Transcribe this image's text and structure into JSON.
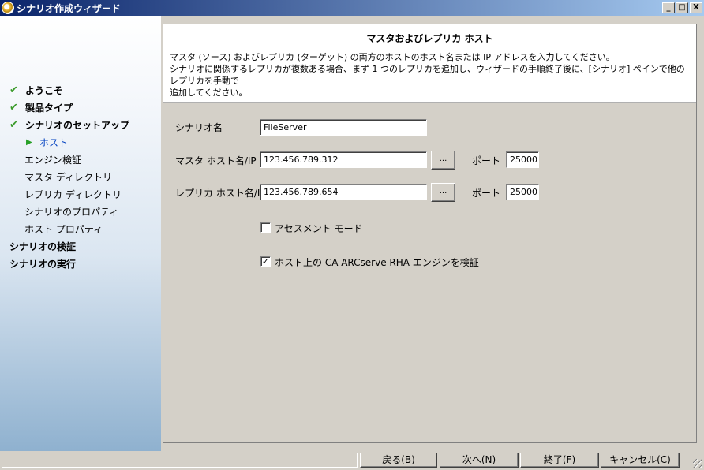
{
  "window": {
    "title": "シナリオ作成ウィザード",
    "minimize": "_",
    "maximize": "□",
    "close": "X"
  },
  "nav": {
    "items": [
      {
        "label": "ようこそ",
        "state": "done"
      },
      {
        "label": "製品タイプ",
        "state": "done"
      },
      {
        "label": "シナリオのセットアップ",
        "state": "done"
      },
      {
        "label": "ホスト",
        "state": "current"
      },
      {
        "label": "エンジン検証",
        "state": "pending"
      },
      {
        "label": "マスタ ディレクトリ",
        "state": "pending"
      },
      {
        "label": "レプリカ ディレクトリ",
        "state": "pending"
      },
      {
        "label": "シナリオのプロパティ",
        "state": "pending"
      },
      {
        "label": "ホスト プロパティ",
        "state": "pending"
      },
      {
        "label": "シナリオの検証",
        "state": "section"
      },
      {
        "label": "シナリオの実行",
        "state": "section"
      }
    ],
    "check_glyph": "✔",
    "arrow_glyph": "▶"
  },
  "header": {
    "title": "マスタおよびレプリカ ホスト",
    "desc_line1": "マスタ (ソース) およびレプリカ (ターゲット) の両方のホストのホスト名または IP アドレスを入力してください。",
    "desc_line2": "シナリオに関係するレプリカが複数ある場合、まず 1 つのレプリカを追加し、ウィザードの手順終了後に、[シナリオ] ペインで他のレプリカを手動で",
    "desc_line3": "追加してください。"
  },
  "form": {
    "scenario_label": "シナリオ名",
    "scenario_value": "FileServer",
    "master_label": "マスタ ホスト名/IP",
    "master_value": "123.456.789.312",
    "replica_label": "レプリカ ホスト名/IP",
    "replica_value": "123.456.789.654",
    "browse_label": "...",
    "port_label": "ポート",
    "master_port": "25000",
    "replica_port": "25000",
    "assessment_label": "アセスメント モード",
    "assessment_checked": false,
    "verify_label": "ホスト上の CA ARCserve RHA エンジンを検証",
    "verify_checked": true,
    "check_mark": "✓"
  },
  "buttons": {
    "back": "戻る(B)",
    "next": "次へ(N)",
    "finish": "終了(F)",
    "cancel": "キャンセル(C)"
  }
}
